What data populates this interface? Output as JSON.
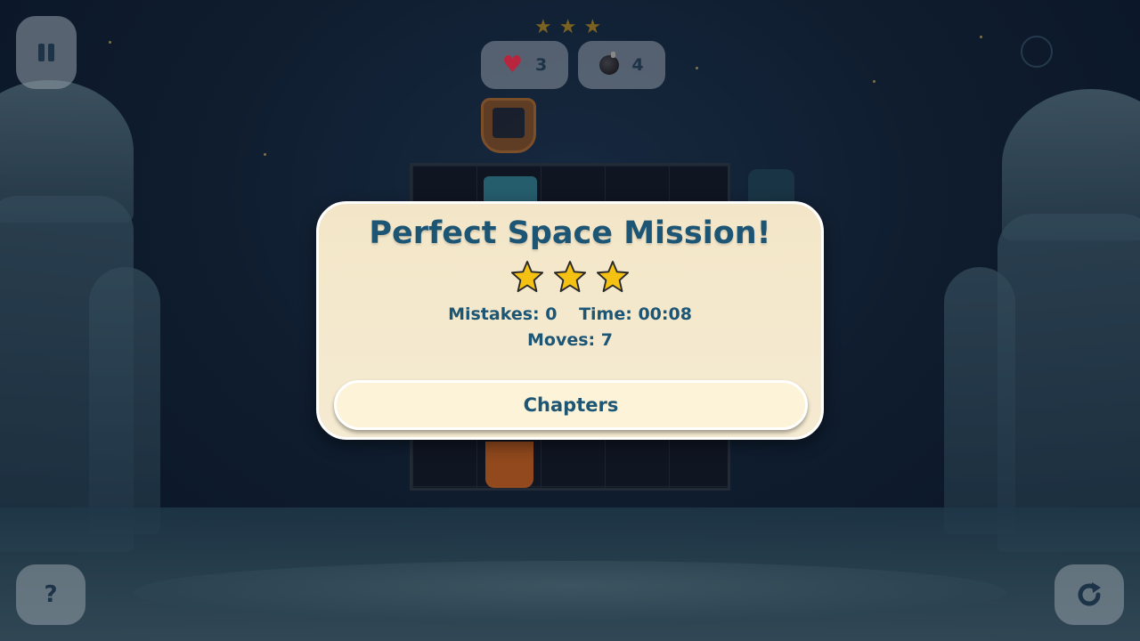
{
  "hud": {
    "stars_earned": 3,
    "lives_icon": "heart-icon",
    "lives_count": "3",
    "bombs_icon": "bomb-icon",
    "bombs_count": "4",
    "pause_icon": "pause-icon",
    "help_icon": "help-icon",
    "help_symbol": "?",
    "restart_icon": "restart-icon"
  },
  "dialog": {
    "title": "Perfect Space Mission!",
    "stars": 3,
    "mistakes": "Mistakes: 0",
    "time": "Time: 00:08",
    "moves": "Moves: 7",
    "chapters_label": "Chapters"
  },
  "colors": {
    "title": "#1d5574",
    "dialog_bg": "#f3e6c8",
    "star_gold": "#f5c214"
  }
}
